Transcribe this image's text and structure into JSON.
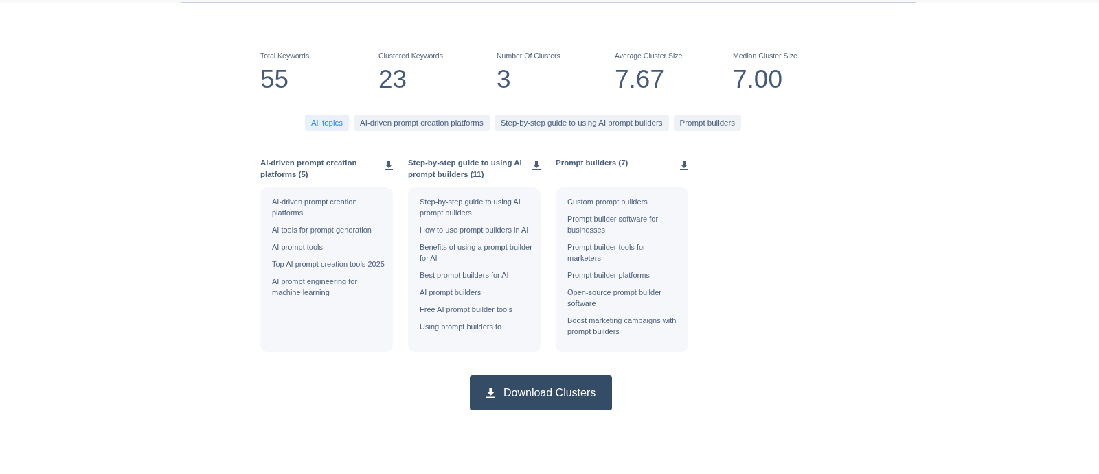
{
  "stats": [
    {
      "label": "Total Keywords",
      "value": "55"
    },
    {
      "label": "Clustered Keywords",
      "value": "23"
    },
    {
      "label": "Number Of Clusters",
      "value": "3"
    },
    {
      "label": "Average Cluster Size",
      "value": "7.67"
    },
    {
      "label": "Median Cluster Size",
      "value": "7.00"
    }
  ],
  "topic_tabs": [
    {
      "label": "All topics",
      "selected": true
    },
    {
      "label": "AI-driven prompt creation platforms",
      "selected": false
    },
    {
      "label": "Step-by-step guide to using AI prompt builders",
      "selected": false
    },
    {
      "label": "Prompt builders",
      "selected": false
    }
  ],
  "clusters": [
    {
      "title": "AI-driven prompt creation platforms (5)",
      "keywords": [
        "AI-driven prompt creation platforms",
        "AI tools for prompt generation",
        "AI prompt tools",
        "Top AI prompt creation tools 2025",
        "AI prompt engineering for machine learning"
      ]
    },
    {
      "title": "Step-by-step guide to using AI prompt builders (11)",
      "keywords": [
        "Step-by-step guide to using AI prompt builders",
        "How to use prompt builders in AI",
        "Benefits of using a prompt builder for AI",
        "Best prompt builders for AI",
        "AI prompt builders",
        "Free AI prompt builder tools",
        "Using prompt builders to"
      ]
    },
    {
      "title": "Prompt builders (7)",
      "keywords": [
        "Custom prompt builders",
        "Prompt builder software for businesses",
        "Prompt builder tools for marketers",
        "Prompt builder platforms",
        "Open-source prompt builder software",
        "Boost marketing campaigns with prompt builders"
      ]
    }
  ],
  "download_button": "Download Clusters"
}
